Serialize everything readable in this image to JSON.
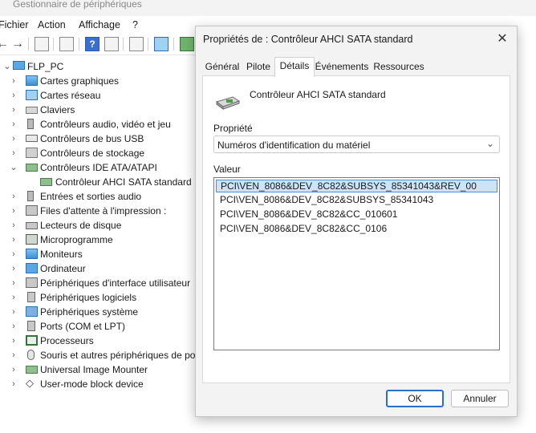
{
  "window": {
    "title": "Gestionnaire de périphériques"
  },
  "menu": [
    "Fichier",
    "Action",
    "Affichage",
    "?"
  ],
  "tree": {
    "root": "FLP_PC",
    "items": [
      {
        "label": "Cartes graphiques",
        "icon": "display-adapter-icon"
      },
      {
        "label": "Cartes réseau",
        "icon": "network-adapter-icon"
      },
      {
        "label": "Claviers",
        "icon": "keyboard-icon"
      },
      {
        "label": "Contrôleurs audio, vidéo et jeu",
        "icon": "speaker-icon"
      },
      {
        "label": "Contrôleurs de bus USB",
        "icon": "usb-icon"
      },
      {
        "label": "Contrôleurs de stockage",
        "icon": "storage-controller-icon"
      },
      {
        "label": "Contrôleurs IDE ATA/ATAPI",
        "icon": "ide-controller-icon",
        "expanded": true
      },
      {
        "label": "Contrôleur AHCI SATA standard",
        "icon": "ide-controller-icon",
        "child": true
      },
      {
        "label": "Entrées et sorties audio",
        "icon": "speaker-icon"
      },
      {
        "label": "Files d'attente à l'impression :",
        "icon": "printer-icon"
      },
      {
        "label": "Lecteurs de disque",
        "icon": "disk-drive-icon"
      },
      {
        "label": "Microprogramme",
        "icon": "firmware-icon"
      },
      {
        "label": "Moniteurs",
        "icon": "monitor-icon"
      },
      {
        "label": "Ordinateur",
        "icon": "computer-icon"
      },
      {
        "label": "Périphériques d'interface utilisateur",
        "icon": "hid-icon"
      },
      {
        "label": "Périphériques logiciels",
        "icon": "software-device-icon"
      },
      {
        "label": "Périphériques système",
        "icon": "system-device-icon"
      },
      {
        "label": "Ports (COM et LPT)",
        "icon": "port-icon"
      },
      {
        "label": "Processeurs",
        "icon": "processor-icon"
      },
      {
        "label": "Souris et autres périphériques de poir",
        "icon": "mouse-icon"
      },
      {
        "label": "Universal Image Mounter",
        "icon": "image-mounter-icon"
      },
      {
        "label": "User-mode block device",
        "icon": "block-device-icon"
      }
    ]
  },
  "dialog": {
    "title": "Propriétés de : Contrôleur AHCI SATA standard",
    "tabs": [
      "Général",
      "Pilote",
      "Détails",
      "Événements",
      "Ressources"
    ],
    "active_tab": "Détails",
    "device_name": "Contrôleur AHCI SATA standard",
    "property_label": "Propriété",
    "property_value": "Numéros d'identification du matériel",
    "value_label": "Valeur",
    "values": [
      "PCI\\VEN_8086&DEV_8C82&SUBSYS_85341043&REV_00",
      "PCI\\VEN_8086&DEV_8C82&SUBSYS_85341043",
      "PCI\\VEN_8086&DEV_8C82&CC_010601",
      "PCI\\VEN_8086&DEV_8C82&CC_0106"
    ],
    "ok_label": "OK",
    "cancel_label": "Annuler"
  },
  "colors": {
    "accent": "#2b6fc8",
    "selection": "#cce4f7"
  }
}
